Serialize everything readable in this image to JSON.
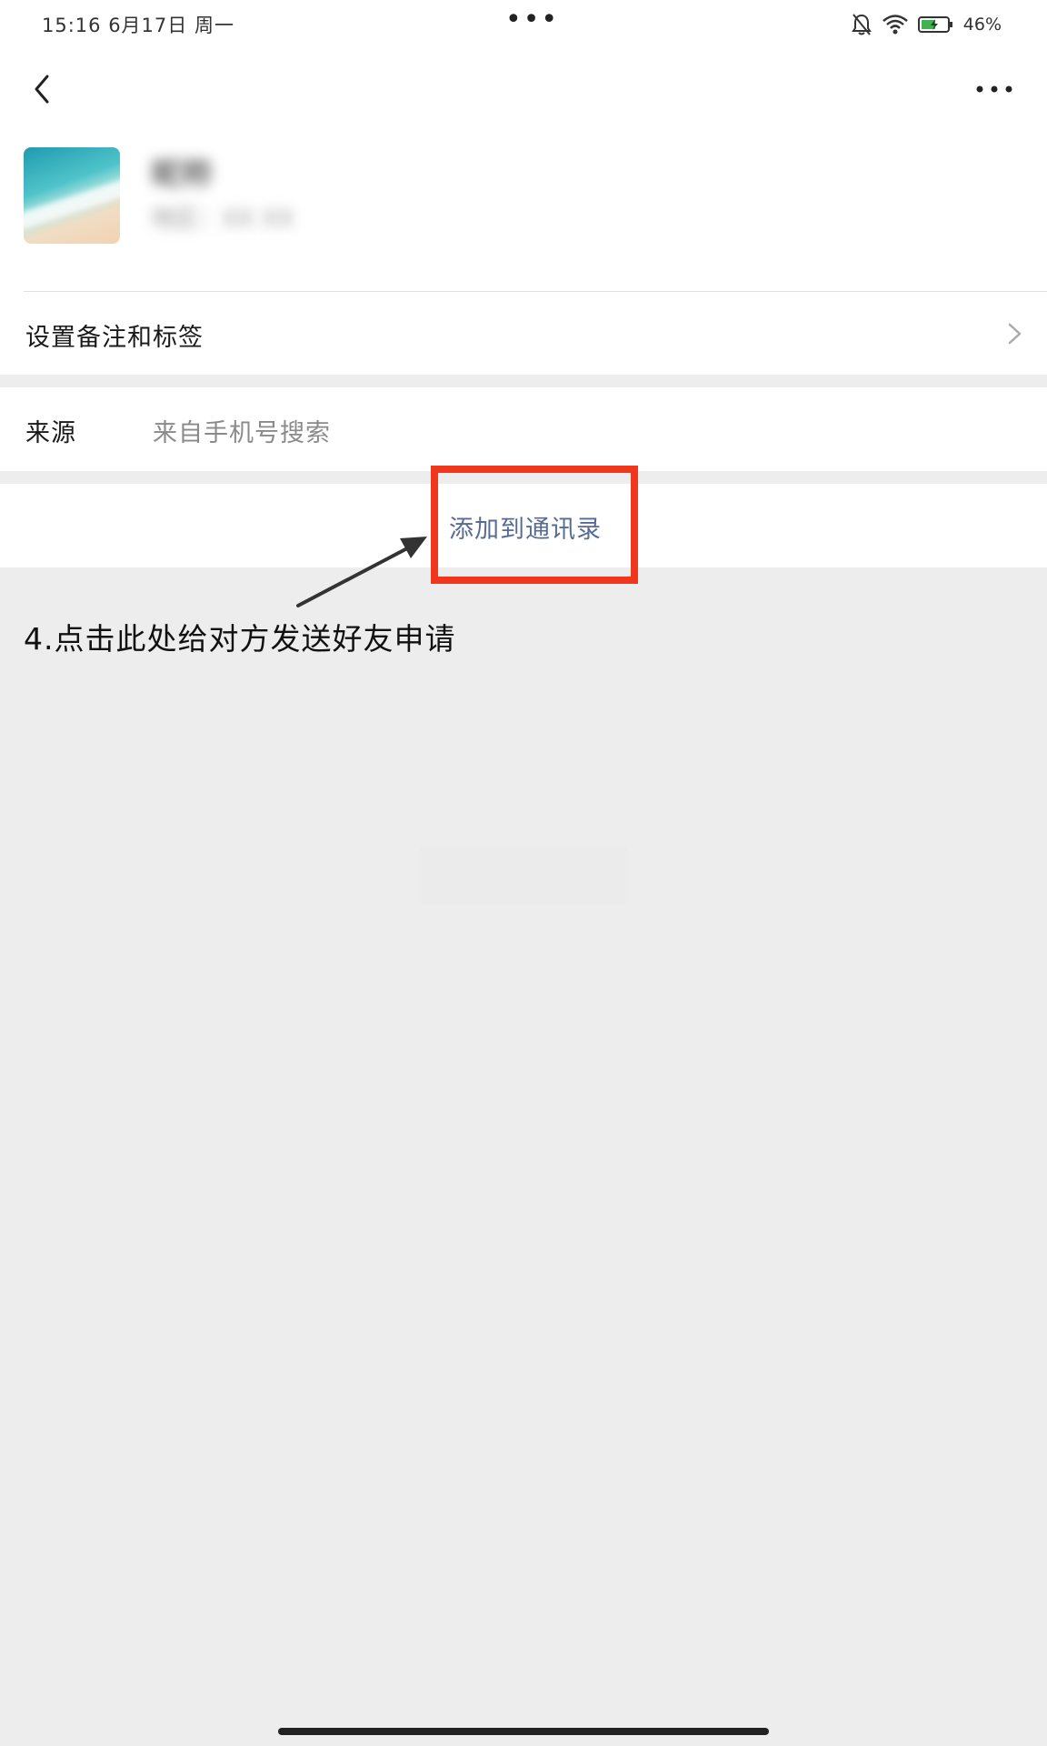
{
  "status_bar": {
    "time": "15:16 6月17日 周一",
    "center": "•••",
    "battery": "46%"
  },
  "nav": {
    "back_icon": "chevron-left-icon",
    "more_icon": "more-dots-icon"
  },
  "profile": {
    "name": "昵称",
    "subtitle": "地区：XX XX"
  },
  "remark": {
    "label": "设置备注和标签"
  },
  "source": {
    "label": "来源",
    "value": "来自手机号搜索"
  },
  "action": {
    "add_label": "添加到通讯录"
  },
  "annotation": {
    "text": "4.点击此处给对方发送好友申请",
    "highlight_color": "#f0361d"
  },
  "colors": {
    "link": "#576b95",
    "background": "#ededed"
  }
}
